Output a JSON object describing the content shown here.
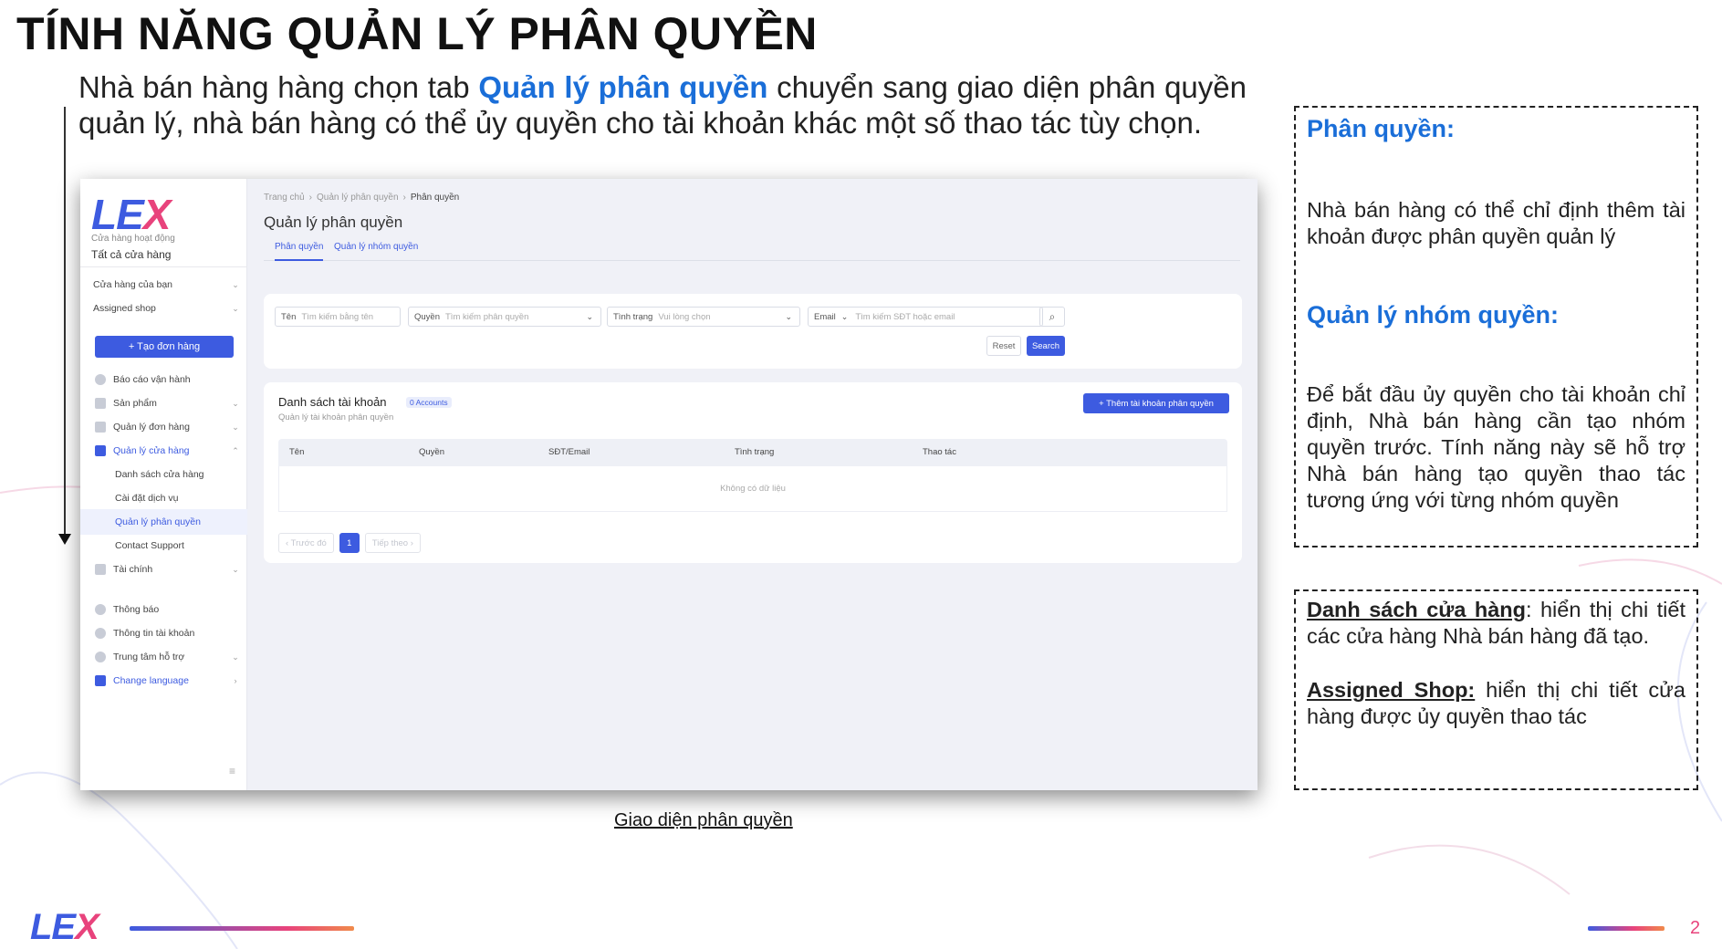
{
  "slide": {
    "title": "TÍNH NĂNG QUẢN LÝ PHÂN QUYỀN",
    "intro_before": "Nhà bán hàng hàng chọn tab ",
    "intro_highlight": "Quản lý phân quyền",
    "intro_after": " chuyển sang giao diện phân quyền quản lý, nhà bán hàng có thể ủy quyền cho tài khoản khác một số thao tác tùy chọn.",
    "caption": "Giao diện phân quyền",
    "page_number": "2",
    "footer_logo": {
      "main": "LE",
      "accent": "X"
    },
    "colors": {
      "accent_blue": "#1a6ed8",
      "brand_blue": "#3d5be0",
      "brand_pink": "#e8437c"
    }
  },
  "app": {
    "logo": {
      "main": "LE",
      "accent": "X"
    },
    "store_status": "Cửa hàng hoạt động",
    "store_name": "Tất cả cửa hàng",
    "sidebar": {
      "items": [
        {
          "label": "Cửa hàng của bạn",
          "chev": "⌄"
        },
        {
          "label": "Assigned shop",
          "chev": "⌄"
        },
        {
          "label": "Báo cáo vận hành"
        },
        {
          "label": "Sản phẩm",
          "chev": "⌄"
        },
        {
          "label": "Quản lý đơn hàng",
          "chev": "⌄"
        },
        {
          "label": "Quản lý cửa hàng",
          "chev": "⌃"
        },
        {
          "label": "Danh sách cửa hàng"
        },
        {
          "label": "Cài đặt dịch vụ"
        },
        {
          "label": "Quản lý phân quyền"
        },
        {
          "label": "Contact Support"
        },
        {
          "label": "Tài chính",
          "chev": "⌄"
        },
        {
          "label": "Thông báo"
        },
        {
          "label": "Thông tin tài khoản"
        },
        {
          "label": "Trung tâm hỗ trợ",
          "chev": "⌄"
        },
        {
          "label": "Change language",
          "chev": "›"
        }
      ],
      "create_order": "+ Tạo đơn hàng",
      "collapse_icon": "≡"
    },
    "breadcrumb": [
      "Trang chủ",
      "Quản lý phân quyền",
      "Phân quyền"
    ],
    "breadcrumb_sep": "›",
    "page_title": "Quản lý phân quyền",
    "tabs": [
      "Phân quyền",
      "Quản lý nhóm quyền"
    ],
    "filters": {
      "name_label": "Tên",
      "name_placeholder": "Tìm kiếm bằng tên",
      "role_label": "Quyền",
      "role_placeholder": "Tìm kiếm phân quyền",
      "status_label": "Tình trạng",
      "status_placeholder": "Vui lòng chọn",
      "contact_type": "Email",
      "contact_placeholder": "Tìm kiếm SĐT hoặc email",
      "dropdown_icon": "⌄",
      "search_icon": "⌕",
      "reset": "Reset",
      "search": "Search"
    },
    "accounts": {
      "title": "Danh sách tài khoản",
      "badge": "0 Accounts",
      "subtitle": "Quản lý tài khoản phân quyền",
      "add_button": "+ Thêm tài khoản phân quyền",
      "columns": [
        "Tên",
        "Quyền",
        "SĐT/Email",
        "Tình trạng",
        "Thao tác"
      ],
      "empty": "Không có dữ liệu",
      "pager": {
        "prev": "‹ Trước đó",
        "page": "1",
        "next": "Tiếp theo ›"
      }
    }
  },
  "notes": {
    "box1_heading1": "Phân quyền:",
    "box1_text1": "Nhà bán hàng có thể chỉ định thêm tài khoản được phân quyền quản lý",
    "box1_heading2": "Quản lý nhóm quyền:",
    "box1_text2": "Để bắt đầu ủy quyền cho tài khoản chỉ định, Nhà bán hàng cần tạo nhóm quyền trước. Tính năng này sẽ hỗ trợ Nhà bán hàng tạo quyền thao tác tương ứng với từng nhóm quyền",
    "box2_term1": "Danh sách cửa hàng",
    "box2_text1": ": hiển thị chi tiết các cửa hàng Nhà bán hàng đã tạo.",
    "box2_term2": "Assigned Shop:",
    "box2_text2": " hiển thị chi tiết cửa hàng được ủy quyền thao tác"
  }
}
